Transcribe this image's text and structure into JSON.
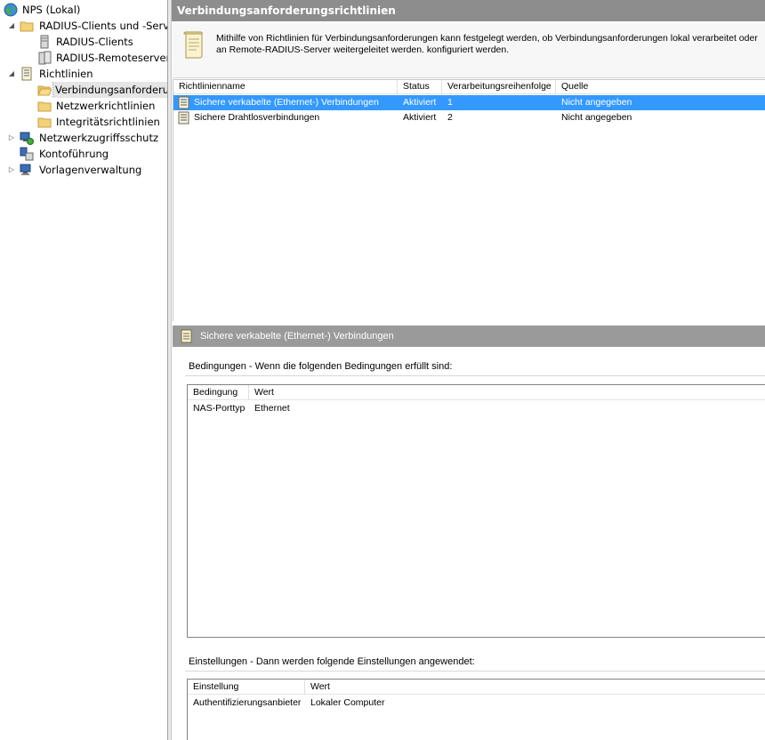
{
  "tree": {
    "items": [
      {
        "label": "NPS (Lokal)",
        "icon": "globe-icon",
        "expander": ""
      },
      {
        "label": "RADIUS-Clients und -Server",
        "icon": "folder-icon",
        "expander": "◢"
      },
      {
        "label": "RADIUS-Clients",
        "icon": "server-icon",
        "expander": ""
      },
      {
        "label": "RADIUS-Remoteservergruppen",
        "icon": "server-group-icon",
        "expander": ""
      },
      {
        "label": "Richtlinien",
        "icon": "policy-icon",
        "expander": "◢"
      },
      {
        "label": "Verbindungsanforderungsrichtlinien",
        "icon": "folder-open-icon",
        "expander": ""
      },
      {
        "label": "Netzwerkrichtlinien",
        "icon": "folder-icon",
        "expander": ""
      },
      {
        "label": "Integritätsrichtlinien",
        "icon": "folder-icon",
        "expander": ""
      },
      {
        "label": "Netzwerkzugriffsschutz",
        "icon": "nap-icon",
        "expander": "▷"
      },
      {
        "label": "Kontoführung",
        "icon": "accounting-icon",
        "expander": ""
      },
      {
        "label": "Vorlagenverwaltung",
        "icon": "templates-icon",
        "expander": "▷"
      }
    ]
  },
  "pane": {
    "title": "Verbindungsanforderungsrichtlinien",
    "help_text": "Mithilfe von Richtlinien für Verbindungsanforderungen kann festgelegt werden, ob Verbindungsanforderungen lokal verarbeitet oder an Remote-RADIUS-Server weitergeleitet werden. konfiguriert werden."
  },
  "list": {
    "columns": [
      "Richtlinienname",
      "Status",
      "Verarbeitungsreihenfolge",
      "Quelle"
    ],
    "rows": [
      {
        "name": "Sichere verkabelte (Ethernet-) Verbindungen",
        "status": "Aktiviert",
        "order": "1",
        "source": "Nicht angegeben",
        "selected": true
      },
      {
        "name": "Sichere Drahtlosverbindungen",
        "status": "Aktiviert",
        "order": "2",
        "source": "Nicht angegeben",
        "selected": false
      }
    ]
  },
  "detail": {
    "title": "Sichere verkabelte (Ethernet-) Verbindungen",
    "conditions": {
      "heading": "Bedingungen - Wenn die folgenden Bedingungen erfüllt sind:",
      "columns": [
        "Bedingung",
        "Wert"
      ],
      "rows": [
        {
          "key": "NAS-Porttyp",
          "value": "Ethernet"
        }
      ]
    },
    "settings": {
      "heading": "Einstellungen - Dann werden folgende Einstellungen angewendet:",
      "columns": [
        "Einstellung",
        "Wert"
      ],
      "rows": [
        {
          "key": "Authentifizierungsanbieter",
          "value": "Lokaler Computer"
        }
      ]
    }
  },
  "colors": {
    "selection": "#3399ff",
    "title_bar": "#8d8d8d",
    "detail_bar": "#9a9a9a"
  }
}
